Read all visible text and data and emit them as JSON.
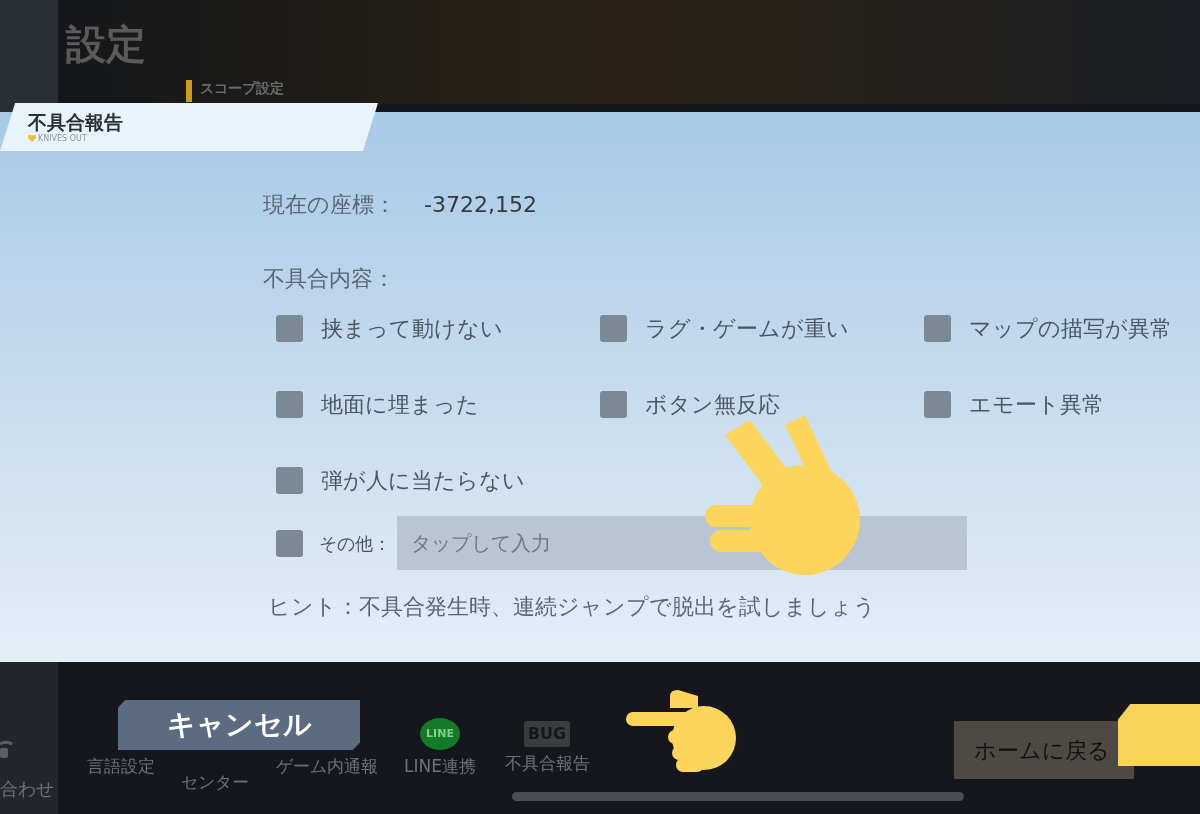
{
  "background": {
    "title": "設定",
    "section_label": "スコープ設定"
  },
  "dialog": {
    "title": "不具合報告",
    "subtitle": "KNIVES OUT",
    "coordinates": {
      "label": "現在の座標：",
      "value": "-3722,152"
    },
    "issues_label": "不具合内容：",
    "options": [
      {
        "label": "挟まって動けない",
        "checked": false
      },
      {
        "label": "ラグ・ゲームが重い",
        "checked": false
      },
      {
        "label": "マップの描写が異常",
        "checked": false
      },
      {
        "label": "地面に埋まった",
        "checked": false
      },
      {
        "label": "ボタン無反応",
        "checked": false
      },
      {
        "label": "エモート異常",
        "checked": false
      },
      {
        "label": "弾が人に当たらない",
        "checked": false
      }
    ],
    "other": {
      "label": "その他：",
      "checked": false,
      "placeholder": "タップして入力"
    },
    "hint": "ヒント：不具合発生時、連続ジャンプで脱出を試しましょう"
  },
  "sidebar": {
    "item": "合わせ"
  },
  "bottom_bar": {
    "items": [
      {
        "kind": "plain",
        "label": "言語設定"
      },
      {
        "kind": "plain",
        "label": "センター"
      },
      {
        "kind": "plain",
        "label": "ゲーム内通報"
      },
      {
        "kind": "line",
        "label": "LINE連携",
        "icon_text": "LINE"
      },
      {
        "kind": "bug",
        "label": "不具合報告",
        "icon_text": "BUG"
      }
    ],
    "cancel_button": "キャンセル",
    "home_button": "ホームに戻る"
  }
}
